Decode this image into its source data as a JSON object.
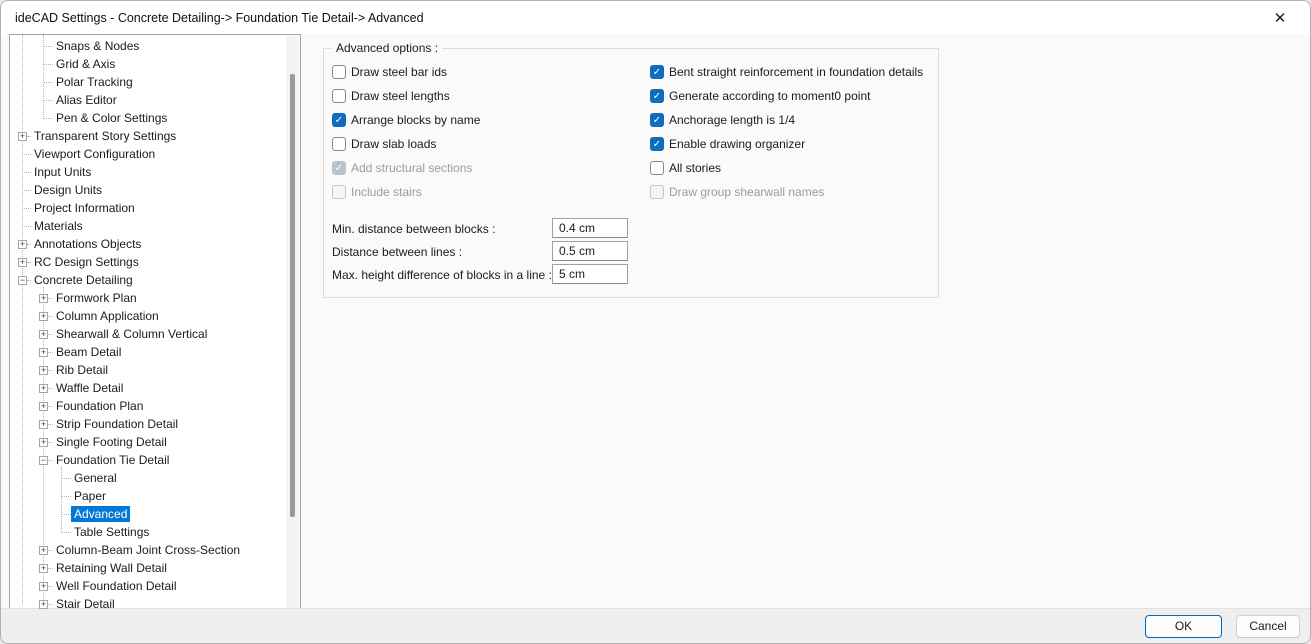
{
  "window": {
    "title": "ideCAD Settings - Concrete Detailing-> Foundation Tie Detail-> Advanced",
    "close_glyph": "✕"
  },
  "colors": {
    "accent": "#0f6cbd",
    "tree_selection": "#0078d7",
    "ok_border": "#0067c0"
  },
  "tree": {
    "items": [
      {
        "label": "Snaps & Nodes",
        "level": 2,
        "glyph": "none",
        "selected": false
      },
      {
        "label": "Grid & Axis",
        "level": 2,
        "glyph": "none",
        "selected": false
      },
      {
        "label": "Polar Tracking",
        "level": 2,
        "glyph": "none",
        "selected": false
      },
      {
        "label": "Alias Editor",
        "level": 2,
        "glyph": "none",
        "selected": false
      },
      {
        "label": "Pen & Color Settings",
        "level": 2,
        "glyph": "none",
        "selected": false
      },
      {
        "label": "Transparent Story Settings",
        "level": 1,
        "glyph": "plus",
        "selected": false
      },
      {
        "label": "Viewport Configuration",
        "level": 1,
        "glyph": "none",
        "selected": false
      },
      {
        "label": "Input Units",
        "level": 1,
        "glyph": "none",
        "selected": false
      },
      {
        "label": "Design Units",
        "level": 1,
        "glyph": "none",
        "selected": false
      },
      {
        "label": "Project Information",
        "level": 1,
        "glyph": "none",
        "selected": false
      },
      {
        "label": "Materials",
        "level": 1,
        "glyph": "none",
        "selected": false
      },
      {
        "label": "Annotations Objects",
        "level": 1,
        "glyph": "plus",
        "selected": false
      },
      {
        "label": "RC Design Settings",
        "level": 1,
        "glyph": "plus",
        "selected": false
      },
      {
        "label": "Concrete Detailing",
        "level": 1,
        "glyph": "minus",
        "selected": false
      },
      {
        "label": "Formwork Plan",
        "level": 2,
        "glyph": "plus",
        "selected": false
      },
      {
        "label": "Column Application",
        "level": 2,
        "glyph": "plus",
        "selected": false
      },
      {
        "label": "Shearwall & Column Vertical",
        "level": 2,
        "glyph": "plus",
        "selected": false
      },
      {
        "label": "Beam Detail",
        "level": 2,
        "glyph": "plus",
        "selected": false
      },
      {
        "label": "Rib Detail",
        "level": 2,
        "glyph": "plus",
        "selected": false
      },
      {
        "label": "Waffle Detail",
        "level": 2,
        "glyph": "plus",
        "selected": false
      },
      {
        "label": "Foundation Plan",
        "level": 2,
        "glyph": "plus",
        "selected": false
      },
      {
        "label": "Strip Foundation Detail",
        "level": 2,
        "glyph": "plus",
        "selected": false
      },
      {
        "label": "Single Footing Detail",
        "level": 2,
        "glyph": "plus",
        "selected": false
      },
      {
        "label": "Foundation Tie Detail",
        "level": 2,
        "glyph": "minus",
        "selected": false
      },
      {
        "label": "General",
        "level": 3,
        "glyph": "none",
        "selected": false
      },
      {
        "label": "Paper",
        "level": 3,
        "glyph": "none",
        "selected": false
      },
      {
        "label": "Advanced",
        "level": 3,
        "glyph": "none",
        "selected": true
      },
      {
        "label": "Table Settings",
        "level": 3,
        "glyph": "none",
        "selected": false
      },
      {
        "label": "Column-Beam Joint Cross-Section",
        "level": 2,
        "glyph": "plus",
        "selected": false
      },
      {
        "label": "Retaining Wall Detail",
        "level": 2,
        "glyph": "plus",
        "selected": false
      },
      {
        "label": "Well Foundation Detail",
        "level": 2,
        "glyph": "plus",
        "selected": false
      },
      {
        "label": "Stair Detail",
        "level": 2,
        "glyph": "plus",
        "selected": false
      }
    ]
  },
  "panel": {
    "group_title": "Advanced options :",
    "checkboxes_left": [
      {
        "label": "Draw steel bar ids",
        "checked": false,
        "enabled": true
      },
      {
        "label": "Draw steel lengths",
        "checked": false,
        "enabled": true
      },
      {
        "label": "Arrange blocks by name",
        "checked": true,
        "enabled": true
      },
      {
        "label": "Draw slab loads",
        "checked": false,
        "enabled": true
      },
      {
        "label": "Add structural sections",
        "checked": true,
        "enabled": false
      },
      {
        "label": "Include stairs",
        "checked": false,
        "enabled": false
      }
    ],
    "checkboxes_right": [
      {
        "label": "Bent straight reinforcement in foundation details",
        "checked": true,
        "enabled": true
      },
      {
        "label": "Generate according to moment0 point",
        "checked": true,
        "enabled": true
      },
      {
        "label": "Anchorage length is 1/4",
        "checked": true,
        "enabled": true
      },
      {
        "label": "Enable drawing organizer",
        "checked": true,
        "enabled": true
      },
      {
        "label": "All stories",
        "checked": false,
        "enabled": true
      },
      {
        "label": "Draw group shearwall names",
        "checked": false,
        "enabled": false
      }
    ],
    "fields": [
      {
        "label": "Min. distance between blocks :",
        "value": "0.4 cm"
      },
      {
        "label": "Distance between lines :",
        "value": "0.5 cm"
      },
      {
        "label": "Max. height difference of blocks in a line :",
        "value": "5 cm"
      }
    ],
    "check_glyph": "✓"
  },
  "footer": {
    "ok_label": "OK",
    "cancel_label": "Cancel"
  }
}
